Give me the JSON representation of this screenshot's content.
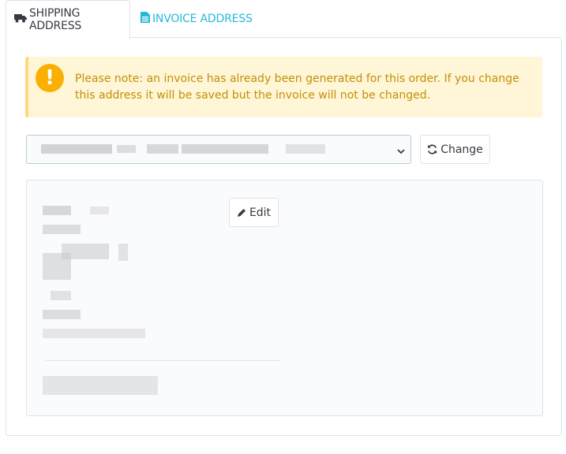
{
  "tabs": [
    {
      "label": "SHIPPING ADDRESS",
      "icon": "truck-icon",
      "active": true
    },
    {
      "label": "INVOICE ADDRESS",
      "icon": "file-icon",
      "active": false
    }
  ],
  "alert": {
    "icon": "exclamation-icon",
    "symbol": "!",
    "text": "Please note: an invoice has already been generated for this order. If you change this address it will be saved but the invoice will not be changed."
  },
  "address_select": {
    "chevron_icon": "chevron-down-icon"
  },
  "change_button": {
    "label": "Change",
    "icon": "refresh-icon"
  },
  "edit_button": {
    "label": "Edit",
    "icon": "pencil-icon"
  },
  "colors": {
    "accent": "#25b9d7",
    "warning": "#fab000",
    "warning_bg": "#fff5d7",
    "warning_text": "#c29106"
  }
}
